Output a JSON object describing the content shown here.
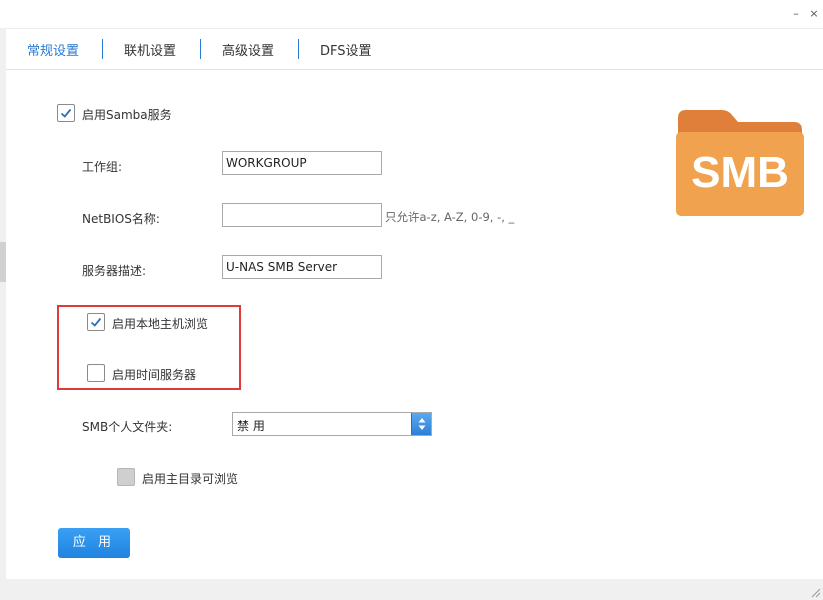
{
  "window": {
    "minimize_glyph": "–",
    "close_glyph": "×"
  },
  "tabs": [
    {
      "label": "常规设置",
      "active": true
    },
    {
      "label": "联机设置",
      "active": false
    },
    {
      "label": "高级设置",
      "active": false
    },
    {
      "label": "DFS设置",
      "active": false
    }
  ],
  "samba": {
    "enable_label": "启用Samba服务",
    "enabled": true
  },
  "workgroup": {
    "label": "工作组:",
    "value": "WORKGROUP"
  },
  "netbios": {
    "label": "NetBIOS名称:",
    "value": "",
    "hint": "只允许a-z, A-Z, 0-9, -, _"
  },
  "server_desc": {
    "label": "服务器描述:",
    "value": "U-NAS SMB Server"
  },
  "local_browse": {
    "label": "启用本地主机浏览",
    "checked": true
  },
  "time_server": {
    "label": "启用时间服务器",
    "checked": false
  },
  "smb_personal": {
    "label": "SMB个人文件夹:",
    "selected": "禁 用"
  },
  "home_browse": {
    "label": "启用主目录可浏览",
    "checked": false,
    "disabled": true
  },
  "apply_button": "应 用",
  "logo": {
    "text": "SMB",
    "icon": "folder-icon",
    "colors": {
      "folder_front": "#f0a24f",
      "folder_back": "#e07f3a"
    }
  },
  "colors": {
    "accent": "#2a7ad1",
    "highlight_border": "#e03a3a",
    "button": "#1f83e0"
  }
}
